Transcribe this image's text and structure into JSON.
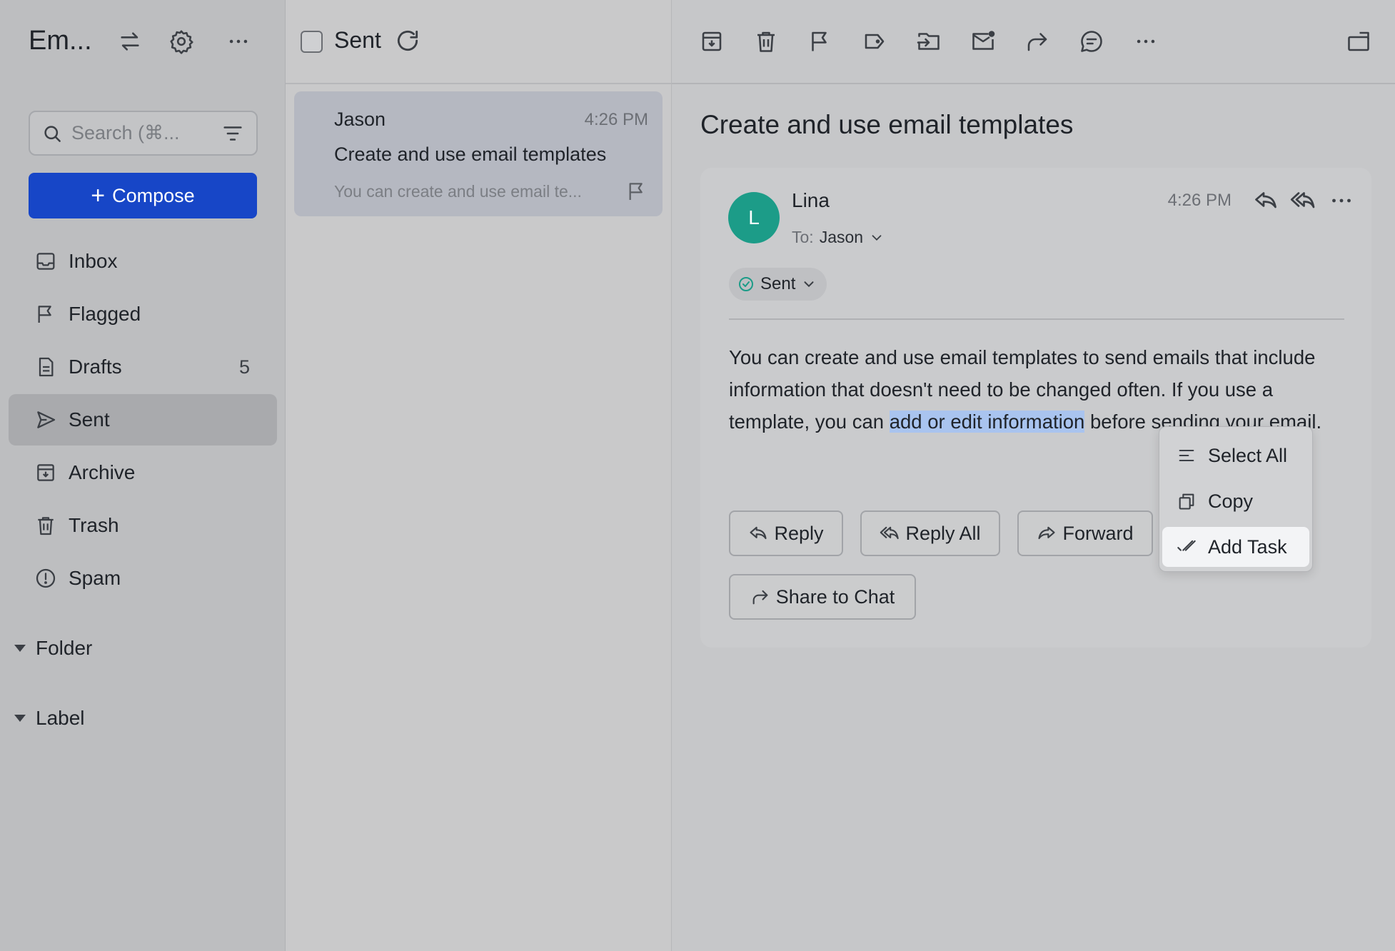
{
  "app": {
    "title": "Em..."
  },
  "sidebar": {
    "search_placeholder": "Search (⌘...",
    "compose_label": "Compose",
    "items": [
      {
        "label": "Inbox",
        "icon": "inbox-icon"
      },
      {
        "label": "Flagged",
        "icon": "flag-icon"
      },
      {
        "label": "Drafts",
        "icon": "drafts-icon",
        "count": "5"
      },
      {
        "label": "Sent",
        "icon": "send-icon",
        "active": true
      },
      {
        "label": "Archive",
        "icon": "archive-icon"
      },
      {
        "label": "Trash",
        "icon": "trash-icon"
      },
      {
        "label": "Spam",
        "icon": "spam-icon"
      }
    ],
    "sections": [
      {
        "label": "Folder"
      },
      {
        "label": "Label"
      }
    ]
  },
  "list": {
    "title": "Sent",
    "messages": [
      {
        "sender": "Jason",
        "time": "4:26 PM",
        "subject": "Create and use email templates",
        "preview": "You can create and use email te..."
      }
    ]
  },
  "reader": {
    "subject": "Create and use email templates",
    "from_name": "Lina",
    "avatar_initial": "L",
    "avatar_color": "#1c9c88",
    "to_label": "To:",
    "to_name": "Jason",
    "time": "4:26 PM",
    "status": "Sent",
    "body_before": "You can create and use email templates to send emails that include information that doesn't need to be changed often. If you use a template, you can ",
    "body_selected": "add or edit information",
    "body_after": " before sending your email.",
    "buttons": {
      "reply": "Reply",
      "reply_all": "Reply All",
      "forward": "Forward",
      "share": "Share to Chat"
    }
  },
  "context_menu": {
    "items": [
      {
        "label": "Select All",
        "icon": "select-all-icon"
      },
      {
        "label": "Copy",
        "icon": "copy-icon"
      },
      {
        "label": "Add Task",
        "icon": "add-task-icon",
        "highlighted": true
      }
    ]
  },
  "colors": {
    "accent": "#1746c7",
    "selection": "#a9c4ef",
    "sent_status": "#1c9c88"
  }
}
